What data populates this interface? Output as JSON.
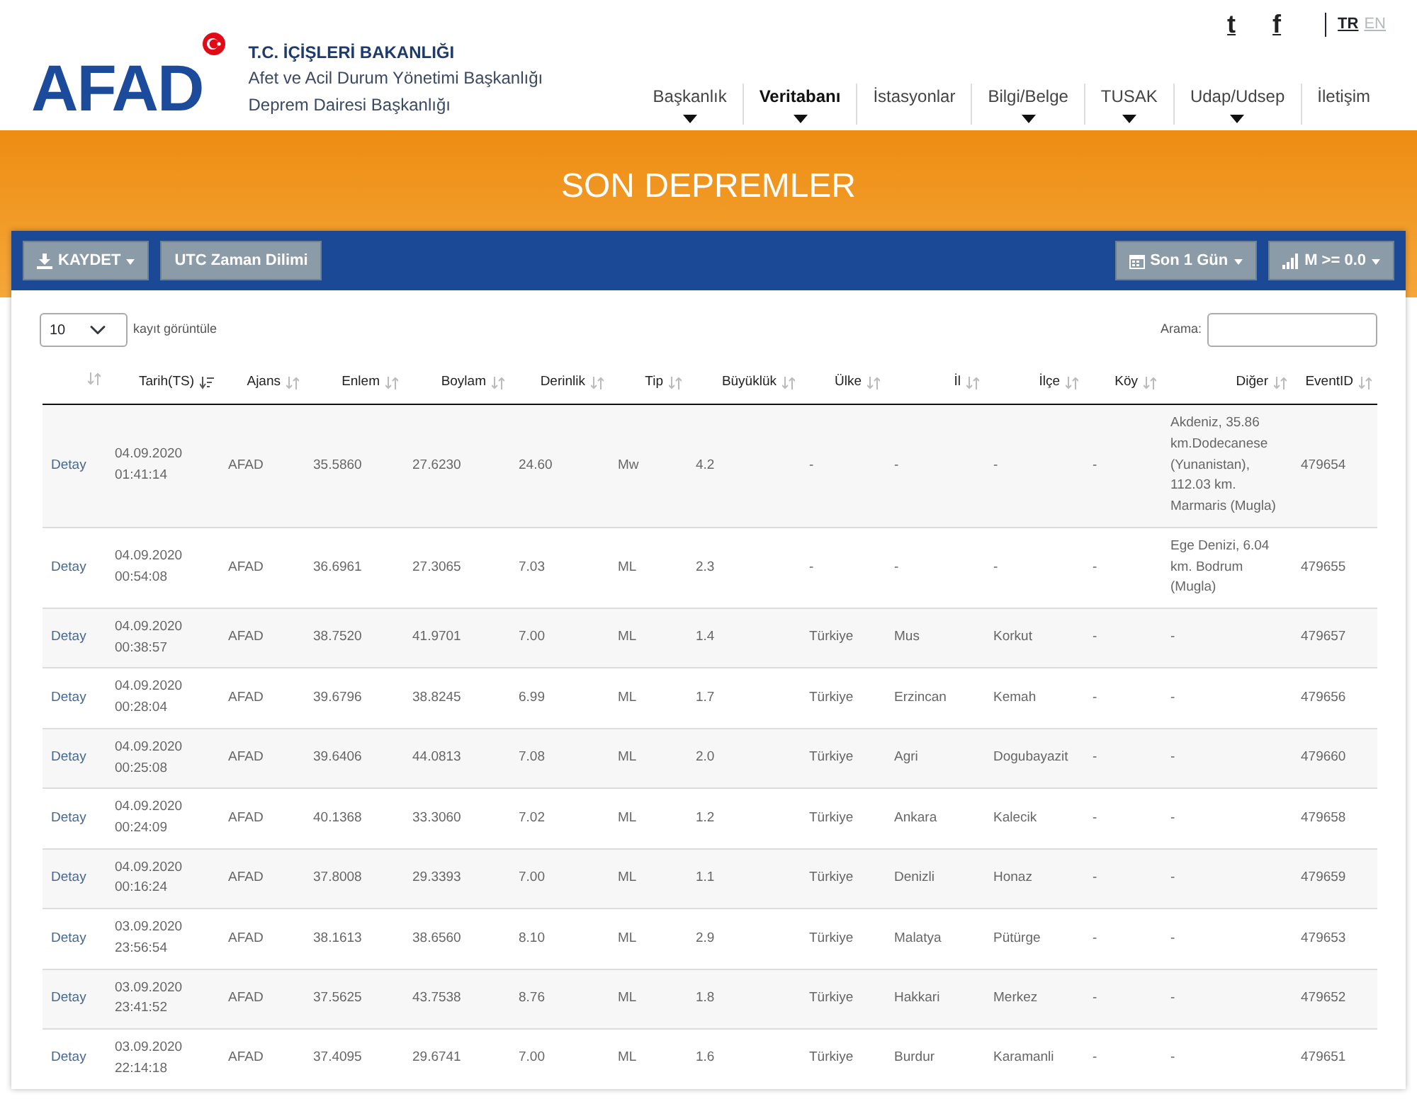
{
  "header": {
    "logo": "AFAD",
    "ministry": "T.C. İÇİŞLERİ BAKANLIĞI",
    "org_lines": [
      "Afet ve Acil Durum Yönetimi Başkanlığı",
      "Deprem Dairesi Başkanlığı"
    ],
    "social": [
      "t",
      "f"
    ],
    "languages": [
      {
        "label": "TR",
        "selected": true
      },
      {
        "label": "EN",
        "selected": false
      }
    ],
    "nav": [
      {
        "label": "Başkanlık",
        "selected": false,
        "has_menu": true
      },
      {
        "label": "Veritabanı",
        "selected": true,
        "has_menu": true
      },
      {
        "label": "İstasyonlar",
        "selected": false,
        "has_menu": false
      },
      {
        "label": "Bilgi/Belge",
        "selected": false,
        "has_menu": true
      },
      {
        "label": "TUSAK",
        "selected": false,
        "has_menu": true
      },
      {
        "label": "Udap/Udsep",
        "selected": false,
        "has_menu": true
      },
      {
        "label": "İletişim",
        "selected": false,
        "has_menu": false
      }
    ]
  },
  "page_title": "SON DEPREMLER",
  "toolbar": {
    "left": [
      {
        "label": "KAYDET",
        "kind": "download",
        "has_menu": true
      },
      {
        "label": "UTC Zaman Dilimi",
        "kind": "plain",
        "has_menu": false
      }
    ],
    "right": [
      {
        "label": "Son 1 Gün",
        "kind": "calendar",
        "has_menu": true
      },
      {
        "label": "M >= 0.0",
        "kind": "signal",
        "has_menu": true
      }
    ]
  },
  "length_select": {
    "value": "10",
    "label": "kayıt görüntüle"
  },
  "search": {
    "label": "Arama:"
  },
  "table": {
    "columns": [
      {
        "sorted": false
      },
      {
        "label": "Tarih(TS)",
        "sorted": true
      },
      {
        "label": "Ajans",
        "sorted": false
      },
      {
        "label": "Enlem",
        "sorted": false
      },
      {
        "label": "Boylam",
        "sorted": false
      },
      {
        "label": "Derinlik",
        "sorted": false
      },
      {
        "label": "Tip",
        "sorted": false
      },
      {
        "label": "Büyüklük",
        "sorted": false
      },
      {
        "label": "Ülke",
        "sorted": false
      },
      {
        "label": "İl",
        "sorted": false
      },
      {
        "label": "İlçe",
        "sorted": false
      },
      {
        "label": "Köy",
        "sorted": false
      },
      {
        "label": "Diğer",
        "sorted": false
      },
      {
        "label": "EventID",
        "sorted": false
      }
    ],
    "rows": [
      [
        "Detay",
        "04.09.2020 01:41:14",
        "AFAD",
        "35.5860",
        "27.6230",
        "24.60",
        "Mw",
        "4.2",
        "-",
        "-",
        "-",
        "-",
        "Akdeniz, 35.86 km.Dodecanese (Yunanistan), 112.03 km. Marmaris (Mugla)",
        "479654"
      ],
      [
        "Detay",
        "04.09.2020 00:54:08",
        "AFAD",
        "36.6961",
        "27.3065",
        "7.03",
        "ML",
        "2.3",
        "-",
        "-",
        "-",
        "-",
        "Ege Denizi, 6.04 km. Bodrum (Mugla)",
        "479655"
      ],
      [
        "Detay",
        "04.09.2020 00:38:57",
        "AFAD",
        "38.7520",
        "41.9701",
        "7.00",
        "ML",
        "1.4",
        "Türkiye",
        "Mus",
        "Korkut",
        "-",
        "-",
        "479657"
      ],
      [
        "Detay",
        "04.09.2020 00:28:04",
        "AFAD",
        "39.6796",
        "38.8245",
        "6.99",
        "ML",
        "1.7",
        "Türkiye",
        "Erzincan",
        "Kemah",
        "-",
        "-",
        "479656"
      ],
      [
        "Detay",
        "04.09.2020 00:25:08",
        "AFAD",
        "39.6406",
        "44.0813",
        "7.08",
        "ML",
        "2.0",
        "Türkiye",
        "Agri",
        "Dogubayazit",
        "-",
        "-",
        "479660"
      ],
      [
        "Detay",
        "04.09.2020 00:24:09",
        "AFAD",
        "40.1368",
        "33.3060",
        "7.02",
        "ML",
        "1.2",
        "Türkiye",
        "Ankara",
        "Kalecik",
        "-",
        "-",
        "479658"
      ],
      [
        "Detay",
        "04.09.2020 00:16:24",
        "AFAD",
        "37.8008",
        "29.3393",
        "7.00",
        "ML",
        "1.1",
        "Türkiye",
        "Denizli",
        "Honaz",
        "-",
        "-",
        "479659"
      ],
      [
        "Detay",
        "03.09.2020 23:56:54",
        "AFAD",
        "38.1613",
        "38.6560",
        "8.10",
        "ML",
        "2.9",
        "Türkiye",
        "Malatya",
        "Pütürge",
        "-",
        "-",
        "479653"
      ],
      [
        "Detay",
        "03.09.2020 23:41:52",
        "AFAD",
        "37.5625",
        "43.7538",
        "8.76",
        "ML",
        "1.8",
        "Türkiye",
        "Hakkari",
        "Merkez",
        "-",
        "-",
        "479652"
      ],
      [
        "Detay",
        "03.09.2020 22:14:18",
        "AFAD",
        "37.4095",
        "29.6741",
        "7.00",
        "ML",
        "1.6",
        "Türkiye",
        "Burdur",
        "Karamanli",
        "-",
        "-",
        "479651"
      ]
    ]
  }
}
